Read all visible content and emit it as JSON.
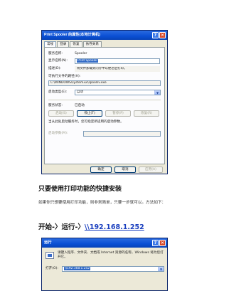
{
  "dialog1": {
    "title": "Print Spooler 的属性(本地计算机)",
    "tabs": [
      "常规",
      "登录",
      "恢复",
      "依存关系"
    ],
    "service_name_label": "服务名称:",
    "service_name": "Spooler",
    "display_name_label": "显示名称(N):",
    "display_name": "Print Spooler",
    "description_label": "描述(D):",
    "description": "将文件加载到内存中以便迟后打印。",
    "exe_path_label": "可执行文件的路径(H):",
    "exe_path": "C:\\WINDOWS\\system32\\spoolsv.exe",
    "startup_type_label": "启动类型(E):",
    "startup_type": "自动",
    "status_label": "服务状态:",
    "status": "已启动",
    "buttons": {
      "start": "启动(S)",
      "stop": "停止(T)",
      "pause": "暂停(P)",
      "resume": "恢复(R)"
    },
    "hint": "当从此处启动服务时，您可指定所适用的启动参数。",
    "params_label": "启动参数(M):",
    "footer": {
      "ok": "确定",
      "cancel": "取消",
      "apply": "应用(A)"
    }
  },
  "article": {
    "heading": "只要使用打印功能的快捷安装",
    "paragraph": "如果你只想要使用打印功能，则非常简单，只要一步就可以。方法如下：",
    "run_prefix": "开始-〉运行-〉",
    "run_path": "\\\\192.168.1.252"
  },
  "dialog2": {
    "title": "运行",
    "prompt": "请键入程序、文件夹、文档或 Internet 资源的名称，Windows 将为您打开它。",
    "open_label": "打开(O):",
    "open_value": "\\\\192.168.1.252"
  }
}
